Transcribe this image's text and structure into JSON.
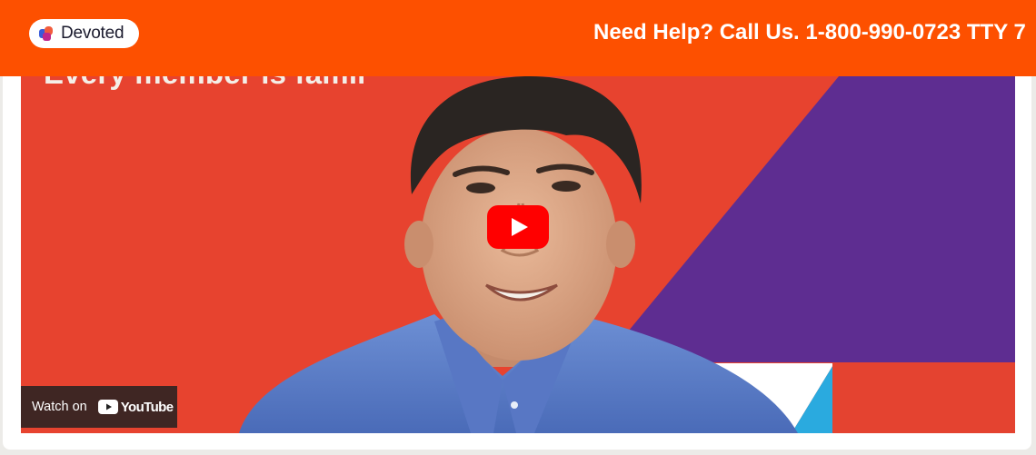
{
  "header": {
    "brand": "Devoted",
    "help_text": "Need Help? Call Us.",
    "phone": "1-800-990-0723",
    "tty": "TTY",
    "tty_tail": "7",
    "background_color": "#fd5000"
  },
  "video": {
    "title_overlay": "Every member is famil",
    "play_button": "play-icon",
    "watch_on_label": "Watch on",
    "youtube_brand": "YouTube",
    "colors": {
      "red": "#e7432f",
      "purple": "#5e2d91",
      "blue": "#2aaadf"
    }
  }
}
